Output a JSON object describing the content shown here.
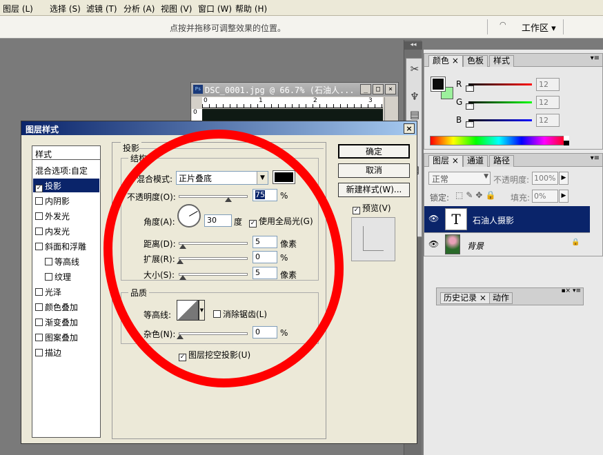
{
  "menu": [
    "图层 (L)",
    "选择 (S)",
    "滤镜 (T)",
    "分析 (A)",
    "视图 (V)",
    "窗口 (W)",
    "帮助 (H)"
  ],
  "options_bar": {
    "hint": "点按并拖移可调整效果的位置。",
    "workspace_label": "工作区 ▾"
  },
  "document_window": {
    "title": "DSC_0001.jpg @ 66.7% (石油人...",
    "ruler": [
      "0",
      "1",
      "2",
      "3"
    ]
  },
  "color_panel": {
    "tabs": [
      "颜色",
      "色板",
      "样式"
    ],
    "channels": [
      {
        "label": "R",
        "value": "12",
        "color": "#cc0000"
      },
      {
        "label": "G",
        "value": "12",
        "color": "#00aa00"
      },
      {
        "label": "B",
        "value": "12",
        "color": "#0000cc"
      }
    ]
  },
  "layers_panel": {
    "tabs": [
      "图层",
      "通道",
      "路径"
    ],
    "blend_mode": "正常",
    "opacity_label": "不透明度:",
    "opacity_value": "100%",
    "lock_label": "锁定:",
    "fill_label": "填充:",
    "fill_value": "0%",
    "layers": [
      {
        "name": "石油人摄影",
        "type": "text",
        "selected": true
      },
      {
        "name": "背景",
        "type": "image",
        "selected": false
      }
    ]
  },
  "history_panel": {
    "tabs": [
      "历史记录",
      "动作"
    ]
  },
  "dialog": {
    "title": "图层样式",
    "styles_header": "样式",
    "styles": [
      {
        "label": "混合选项:自定",
        "checkbox": false
      },
      {
        "label": "投影",
        "checkbox": true,
        "checked": true,
        "selected": true
      },
      {
        "label": "内阴影",
        "checkbox": true
      },
      {
        "label": "外发光",
        "checkbox": true
      },
      {
        "label": "内发光",
        "checkbox": true
      },
      {
        "label": "斜面和浮雕",
        "checkbox": true
      },
      {
        "label": "等高线",
        "checkbox": true,
        "indent": true
      },
      {
        "label": "纹理",
        "checkbox": true,
        "indent": true
      },
      {
        "label": "光泽",
        "checkbox": true
      },
      {
        "label": "颜色叠加",
        "checkbox": true
      },
      {
        "label": "渐变叠加",
        "checkbox": true
      },
      {
        "label": "图案叠加",
        "checkbox": true
      },
      {
        "label": "描边",
        "checkbox": true
      }
    ],
    "section_title": "投影",
    "structure": {
      "title": "结构",
      "blend_label": "混合模式:",
      "blend_value": "正片叠底",
      "opacity_label": "不透明度(O):",
      "opacity_value": "75",
      "percent": "%",
      "angle_label": "角度(A):",
      "angle_value": "30",
      "degree_unit": "度",
      "global_light_label": "使用全局光(G)",
      "distance_label": "距离(D):",
      "distance_value": "5",
      "spread_label": "扩展(R):",
      "spread_value": "0",
      "size_label": "大小(S):",
      "size_value": "5",
      "px_unit": "像素"
    },
    "quality": {
      "title": "品质",
      "contour_label": "等高线:",
      "antialias_label": "消除锯齿(L)",
      "noise_label": "杂色(N):",
      "noise_value": "0"
    },
    "knockout_label": "图层挖空投影(U)",
    "buttons": {
      "ok": "确定",
      "cancel": "取消",
      "new_style": "新建样式(W)...",
      "preview": "预览(V)"
    }
  },
  "colors": {
    "annotation": "#ff0000",
    "selection": "#0a246a"
  }
}
